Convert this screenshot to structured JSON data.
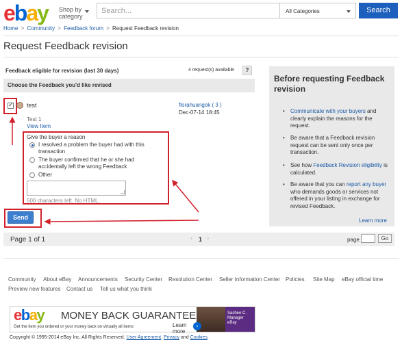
{
  "header": {
    "logo": {
      "e1": "e",
      "b": "b",
      "a": "a",
      "y": "y"
    },
    "shop_by": "Shop by",
    "category": "category",
    "search_placeholder": "Search...",
    "category_select": "All Categories",
    "search_button": "Search"
  },
  "breadcrumb": {
    "home": "Home",
    "community": "Community",
    "forum": "Feedback forum",
    "current": "Request Feedback revision",
    "sep": ">"
  },
  "page_title": "Request Feedback revision",
  "left": {
    "eligible_label": "Feedback eligible for revision (last 30 days)",
    "requests_available": "4 request(s) available",
    "help_button": "?",
    "choose_label": "Choose the Feedback you'd like revised",
    "item": {
      "checked_mark": "✓",
      "name": "test",
      "sub": "Test 1",
      "view_item": "View Item",
      "buyer": "florahuangok ( 3 )",
      "date": "Dec-07-14 18:45"
    },
    "reason": {
      "label": "Give the buyer a reason",
      "options": [
        "I resolved a problem the buyer had with this transaction",
        "The buyer confirmed that he or she had accidentally left the wrong Feedback",
        "Other"
      ],
      "chars_left": "500 characters left. No HTML."
    },
    "send_button": "Send",
    "pager": {
      "page_of": "Page 1 of 1",
      "prev": "‹",
      "current": "1",
      "next": "›",
      "page_label": "page",
      "go_button": "Go"
    }
  },
  "right": {
    "title": "Before requesting Feedback revision",
    "b1_link": "Communicate with your buyers",
    "b1_text": " and clearly explain the reasons for the request.",
    "b2_text": "Be aware that a Feedback revision request can be sent only once per transaction.",
    "b3_pre": "See how ",
    "b3_link": "Feedback Revision eligibility",
    "b3_post": " is calculated.",
    "b4_pre": "Be aware that you can ",
    "b4_link": "report any buyer",
    "b4_post": " who demands goods or services not offered in your listing in exchange for revised Feedback.",
    "learn_more": "Learn more"
  },
  "footer": {
    "row1": [
      "Community",
      "About eBay",
      "Announcements",
      "Security Center",
      "Resolution Center",
      "Seller Information Center",
      "Policies",
      "Site Map",
      "eBay official time"
    ],
    "row2": [
      "Preview new features",
      "Contact us",
      "Tell us what you think"
    ]
  },
  "banner": {
    "logo": {
      "e1": "e",
      "b": "b",
      "a": "a",
      "y": "y"
    },
    "headline": "MONEY BACK GUARANTEE",
    "sub": "Get the item you ordered or your money back on virtually all items",
    "learn_more": "Learn more",
    "arrow": "›",
    "name_line1": "Sashee C.",
    "name_line2": "Manager",
    "name_line3": "eBay"
  },
  "copyright": {
    "text": "Copyright © 1995-2014 eBay Inc. All Rights Reserved.",
    "user_agreement": "User Agreement",
    "privacy": "Privacy",
    "and": "and",
    "cookies": "Cookies"
  },
  "colors": {
    "accent": "#1d5fbd",
    "annotation": "#d0202a",
    "link": "#1a5aa6"
  }
}
